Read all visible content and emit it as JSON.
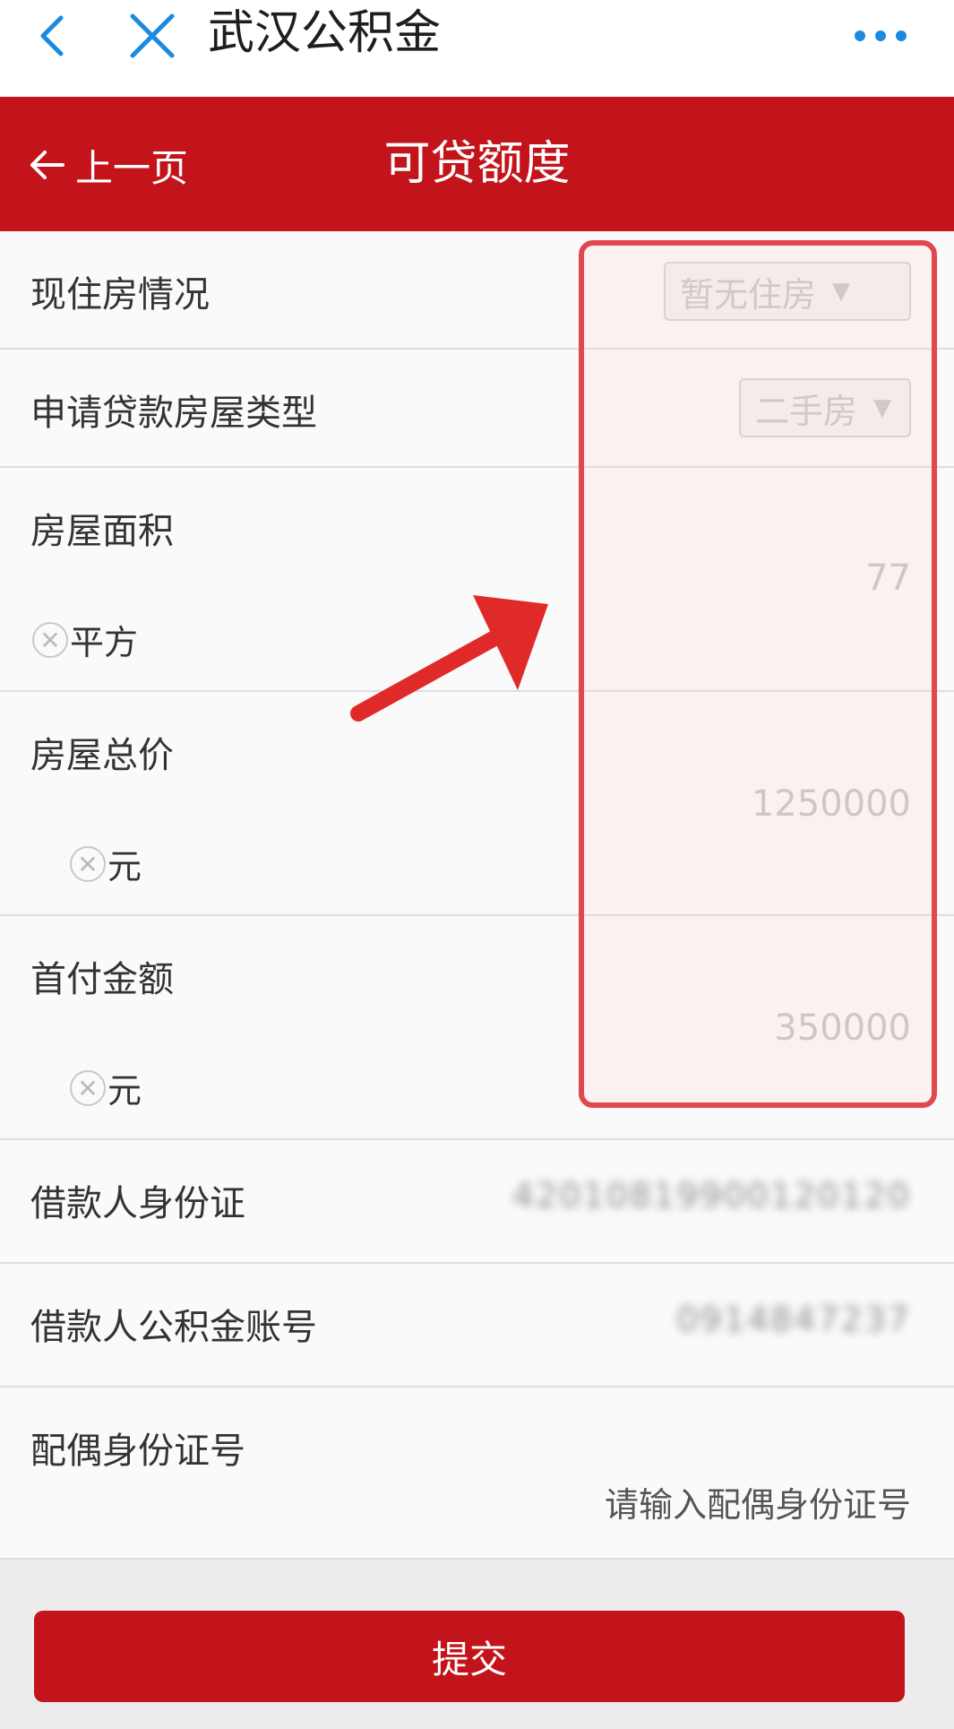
{
  "topbar": {
    "title": "武汉公积金"
  },
  "header": {
    "prev_label": "上一页",
    "page_title": "可贷额度"
  },
  "form": {
    "housing_status": {
      "label": "现住房情况",
      "value": "暂无住房"
    },
    "house_type": {
      "label": "申请贷款房屋类型",
      "value": "二手房"
    },
    "area": {
      "label": "房屋面积",
      "value": "77",
      "unit": "平方"
    },
    "total_price": {
      "label": "房屋总价",
      "value": "1250000",
      "unit": "元"
    },
    "down_payment": {
      "label": "首付金额",
      "value": "350000",
      "unit": "元"
    },
    "borrower_id": {
      "label": "借款人身份证",
      "value": "42010819900120120"
    },
    "borrower_account": {
      "label": "借款人公积金账号",
      "value": "0914847237"
    },
    "spouse_id": {
      "label": "配偶身份证号",
      "placeholder": "请输入配偶身份证号"
    }
  },
  "submit_label": "提交",
  "colors": {
    "brand_red": "#c4141b",
    "highlight": "#e0484e",
    "nav_blue": "#1a8ae0"
  }
}
